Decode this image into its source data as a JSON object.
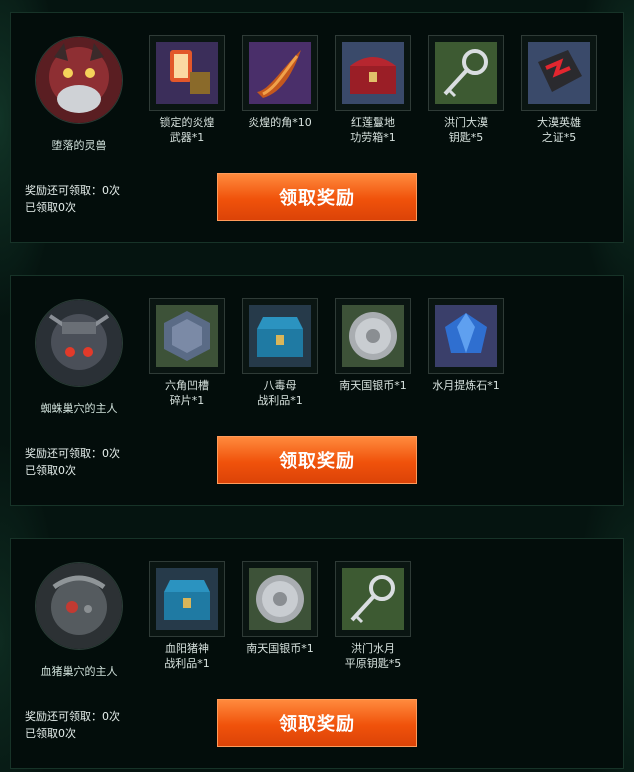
{
  "panels": [
    {
      "boss_name": "堕落的灵兽",
      "avatar_icon": "fallen-beast-avatar",
      "items": [
        {
          "label": "锁定的炎煌\n武器*1",
          "icon": "locked-weapon-icon"
        },
        {
          "label": "炎煌的角*10",
          "icon": "flame-horn-icon"
        },
        {
          "label": "红莲鬘地\n功劳箱*1",
          "icon": "red-chest-icon"
        },
        {
          "label": "洪门大漠\n钥匙*5",
          "icon": "key-icon"
        },
        {
          "label": "大漠英雄\n之证*5",
          "icon": "hero-badge-icon"
        }
      ],
      "remaining": "奖励还可领取：0次",
      "claimed": "已领取0次",
      "button": "领取奖励"
    },
    {
      "boss_name": "蜘蛛巢穴的主人",
      "avatar_icon": "spider-lord-avatar",
      "items": [
        {
          "label": "六角凹槽\n碎片*1",
          "icon": "hex-fragment-icon"
        },
        {
          "label": "八毒母\n战利品*1",
          "icon": "blue-chest-icon"
        },
        {
          "label": "南天国银币*1",
          "icon": "silver-coin-icon"
        },
        {
          "label": "水月提炼石*1",
          "icon": "blue-gem-icon"
        }
      ],
      "remaining": "奖励还可领取：0次",
      "claimed": "已领取0次",
      "button": "领取奖励"
    },
    {
      "boss_name": "血猪巢穴的主人",
      "avatar_icon": "blood-boar-avatar",
      "items": [
        {
          "label": "血阳猪神\n战利品*1",
          "icon": "blue-chest-icon"
        },
        {
          "label": "南天国银币*1",
          "icon": "silver-coin-icon"
        },
        {
          "label": "洪门水月\n平原钥匙*5",
          "icon": "key-icon"
        }
      ],
      "remaining": "奖励还可领取：0次",
      "claimed": "已领取0次",
      "button": "领取奖励"
    }
  ],
  "colors": {
    "button": "#f0520b",
    "panel_border": "#173328",
    "background": "#051410"
  }
}
